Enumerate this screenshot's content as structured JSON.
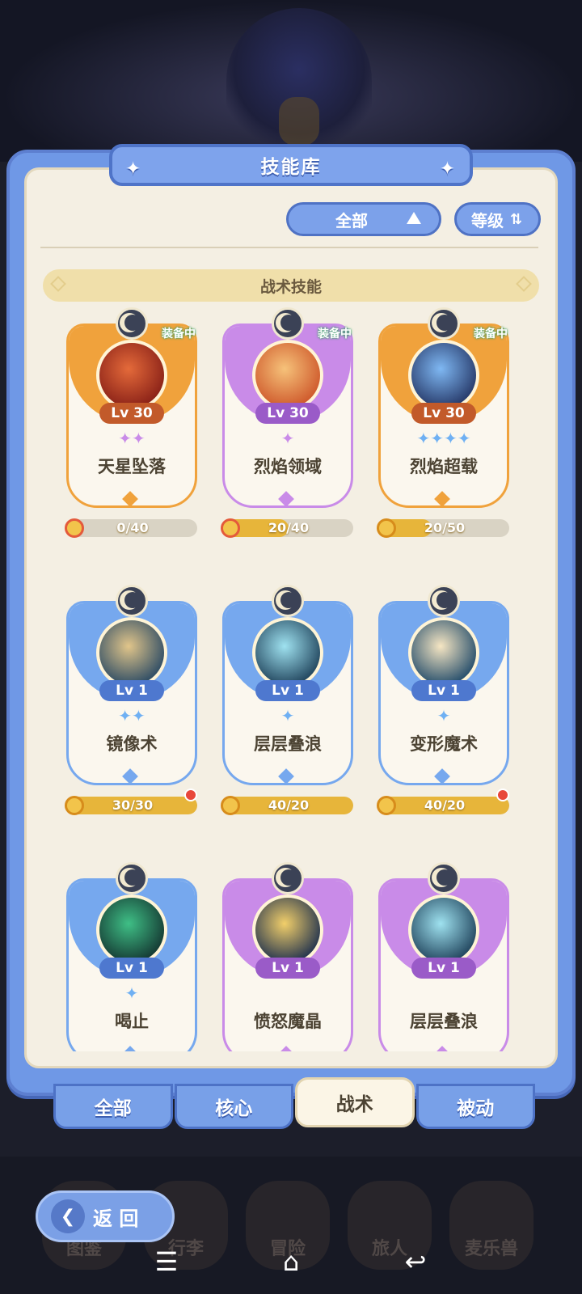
{
  "title": "技能库",
  "filters": {
    "category": "全部",
    "sort": "等级"
  },
  "section": "战术技能",
  "skills": [
    {
      "name": "天星坠落",
      "level": "Lv 30",
      "equipped": "装备中",
      "gems": "✦✦",
      "progress": "0/40",
      "progress_value": 0,
      "color": "#f0a23c",
      "icon_colors": [
        "#e46a3a",
        "#8b2218"
      ],
      "red_dot": false
    },
    {
      "name": "烈焰领域",
      "level": "Lv 30",
      "equipped": "装备中",
      "gems": "✦",
      "progress": "20/40",
      "progress_value": 0.5,
      "color": "#c98be8",
      "icon_colors": [
        "#f6c27a",
        "#cf5a2c"
      ],
      "red_dot": false
    },
    {
      "name": "烈焰超载",
      "level": "Lv 30",
      "equipped": "装备中",
      "gems": "✦✦✦✦",
      "progress": "20/50",
      "progress_value": 0.4,
      "color": "#f0a23c",
      "icon_colors": [
        "#7fb8f3",
        "#283b6b"
      ],
      "red_dot": false
    },
    {
      "name": "镜像术",
      "level": "Lv 1",
      "equipped": "",
      "gems": "✦✦",
      "progress": "30/30",
      "progress_value": 1,
      "color": "#76a8ee",
      "icon_colors": [
        "#e1c58a",
        "#2f4d65"
      ],
      "red_dot": true
    },
    {
      "name": "层层叠浪",
      "level": "Lv 1",
      "equipped": "",
      "gems": "✦",
      "progress": "40/20",
      "progress_value": 1,
      "color": "#76a8ee",
      "icon_colors": [
        "#9fe2f0",
        "#23475f"
      ],
      "red_dot": false
    },
    {
      "name": "变形魔术",
      "level": "Lv 1",
      "equipped": "",
      "gems": "✦",
      "progress": "40/20",
      "progress_value": 1,
      "color": "#76a8ee",
      "icon_colors": [
        "#f6e6c3",
        "#274f6c"
      ],
      "red_dot": true
    },
    {
      "name": "喝止",
      "level": "Lv 1",
      "equipped": "",
      "gems": "✦",
      "progress": "",
      "progress_value": 0,
      "color": "#76a8ee",
      "icon_colors": [
        "#3fbf86",
        "#153a33"
      ],
      "red_dot": false
    },
    {
      "name": "愤怒魔晶",
      "level": "Lv 1",
      "equipped": "",
      "gems": "",
      "progress": "",
      "progress_value": 0,
      "color": "#c98be8",
      "icon_colors": [
        "#f2cf6a",
        "#25354e"
      ],
      "red_dot": false
    },
    {
      "name": "层层叠浪",
      "level": "Lv 1",
      "equipped": "",
      "gems": "",
      "progress": "",
      "progress_value": 0,
      "color": "#c98be8",
      "icon_colors": [
        "#9fe2f0",
        "#23475f"
      ],
      "red_dot": false
    }
  ],
  "tabs": [
    {
      "label": "全部",
      "active": false
    },
    {
      "label": "核心",
      "active": false
    },
    {
      "label": "战术",
      "active": true
    },
    {
      "label": "被动",
      "active": false
    }
  ],
  "background_menu": [
    "图鉴",
    "行李",
    "冒险",
    "旅人",
    "麦乐兽"
  ],
  "back_label": "返 回",
  "nav_icons": [
    "menu-icon",
    "home-icon",
    "back-icon"
  ]
}
